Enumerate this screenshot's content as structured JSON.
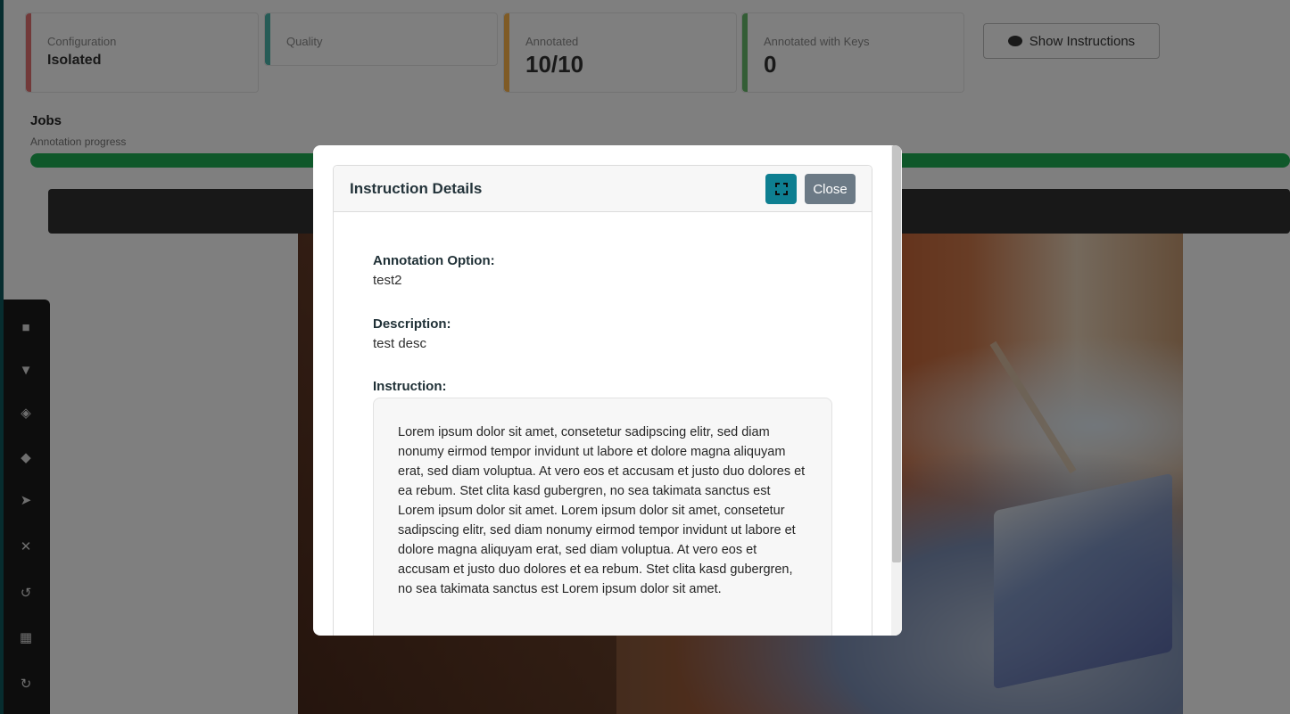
{
  "background": {
    "stats": [
      {
        "label": "Configuration",
        "value": "Isolated"
      },
      {
        "label": "Quality",
        "value": ""
      },
      {
        "label": "Annotated",
        "value": "10/10"
      },
      {
        "label": "Annotated with Keys",
        "value": "0"
      }
    ],
    "show_instructions_label": "Show Instructions",
    "job_title": "Jobs",
    "job_subtitle": "Annotation progress",
    "progress_percent": 100,
    "accent_colors": [
      "#e57373",
      "#4db6ac",
      "#ffb74d",
      "#66bb6a"
    ],
    "toolbar_icons": [
      "home-icon",
      "filter-icon",
      "layers-icon",
      "tag-icon",
      "move-icon",
      "close-icon",
      "undo-icon",
      "grid-icon",
      "redo-icon"
    ]
  },
  "modal": {
    "title": "Instruction Details",
    "expand_icon": "fullscreen-icon",
    "close_label": "Close",
    "annotation_option_label": "Annotation Option:",
    "annotation_option_value": "test2",
    "description_label": "Description:",
    "description_value": "test desc",
    "instruction_label": "Instruction:",
    "instruction_text": "Lorem ipsum dolor sit amet, consetetur sadipscing elitr, sed diam nonumy eirmod tempor invidunt ut labore et dolore magna aliquyam erat, sed diam voluptua. At vero eos et accusam et justo duo dolores et ea rebum. Stet clita kasd gubergren, no sea takimata sanctus est Lorem ipsum dolor sit amet. Lorem ipsum dolor sit amet, consetetur sadipscing elitr, sed diam nonumy eirmod tempor invidunt ut labore et dolore magna aliquyam erat, sed diam voluptua. At vero eos et accusam et justo duo dolores et ea rebum. Stet clita kasd gubergren, no sea takimata sanctus est Lorem ipsum dolor sit amet."
  },
  "colors": {
    "expand_button": "#0e7f91",
    "close_button": "#6c7a86",
    "progress": "#1fb155"
  }
}
